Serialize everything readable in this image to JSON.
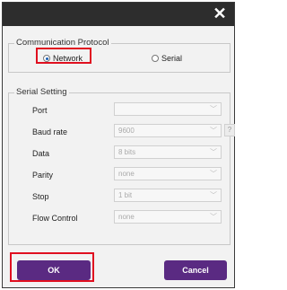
{
  "close_glyph": "✕",
  "protocol": {
    "title": "Communication Protocol",
    "options": [
      {
        "label": "Network",
        "selected": true
      },
      {
        "label": "Serial",
        "selected": false
      }
    ]
  },
  "serial": {
    "title": "Serial Setting",
    "fields": [
      {
        "label": "Port",
        "value": ""
      },
      {
        "label": "Baud rate",
        "value": "9600"
      },
      {
        "label": "Data",
        "value": "8 bits"
      },
      {
        "label": "Parity",
        "value": "none"
      },
      {
        "label": "Stop",
        "value": "1 bit"
      },
      {
        "label": "Flow Control",
        "value": "none"
      }
    ],
    "help_label": "?"
  },
  "buttons": {
    "ok": "OK",
    "cancel": "Cancel"
  },
  "colors": {
    "titlebar": "#2d2d2d",
    "button": "#5a2a82",
    "highlight": "#e01020"
  },
  "icons": {
    "close": "close-icon",
    "chevron": "chevron-down-icon"
  }
}
